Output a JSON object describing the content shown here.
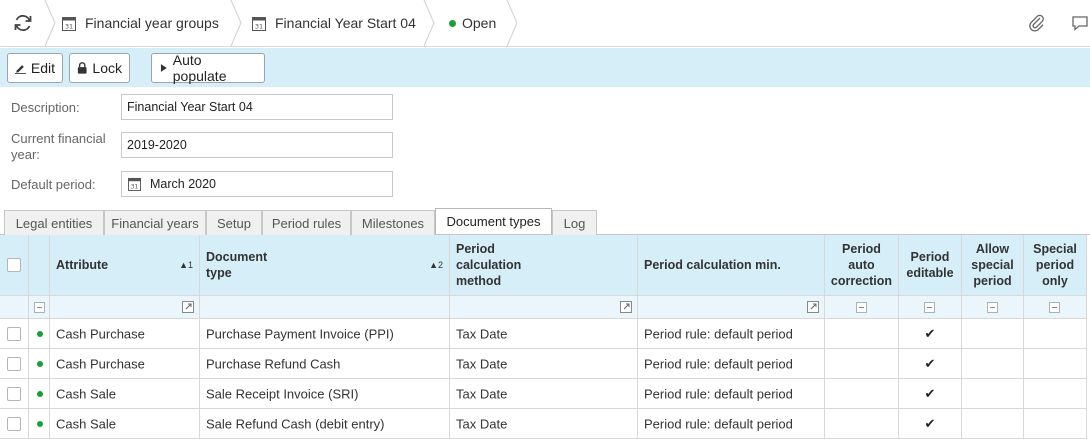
{
  "breadcrumb": {
    "item1": "Financial year groups",
    "item2": "Financial Year Start 04",
    "status": "Open"
  },
  "toolbar": {
    "edit": "Edit",
    "lock": "Lock",
    "auto_populate": "Auto populate"
  },
  "form": {
    "description_label": "Description:",
    "description_value": "Financial Year Start 04",
    "current_year_label_line1": "Current financial",
    "current_year_label_line2": "year:",
    "current_year_value": "2019-2020",
    "default_period_label": "Default period:",
    "default_period_value": "March 2020"
  },
  "tabs": [
    "Legal entities",
    "Financial years",
    "Setup",
    "Period rules",
    "Milestones",
    "Document types",
    "Log"
  ],
  "active_tab": "Document types",
  "columns": {
    "attribute": "Attribute",
    "attribute_sort": "1",
    "document_type_1": "Document",
    "document_type_2": "type",
    "document_type_sort": "2",
    "period_calc_1": "Period",
    "period_calc_2": "calculation",
    "period_calc_3": "method",
    "period_calc_min": "Period calculation min.",
    "auto_corr_1": "Period",
    "auto_corr_2": "auto",
    "auto_corr_3": "correction",
    "editable_1": "Period",
    "editable_2": "editable",
    "allow_special_1": "Allow",
    "allow_special_2": "special",
    "allow_special_3": "period",
    "special_only_1": "Special",
    "special_only_2": "period",
    "special_only_3": "only"
  },
  "rows": [
    {
      "attribute": "Cash Purchase",
      "document_type": "Purchase Payment Invoice (PPI)",
      "method": "Tax Date",
      "min": "Period rule: default period",
      "editable": "✔"
    },
    {
      "attribute": "Cash Purchase",
      "document_type": "Purchase Refund Cash",
      "method": "Tax Date",
      "min": "Period rule: default period",
      "editable": "✔"
    },
    {
      "attribute": "Cash Sale",
      "document_type": "Sale Receipt Invoice (SRI)",
      "method": "Tax Date",
      "min": "Period rule: default period",
      "editable": "✔"
    },
    {
      "attribute": "Cash Sale",
      "document_type": "Sale Refund Cash (debit entry)",
      "method": "Tax Date",
      "min": "Period rule: default period",
      "editable": "✔"
    }
  ],
  "icons": {
    "refresh": "refresh-icon",
    "calendar": "calendar-icon",
    "attach": "paperclip-icon",
    "comment": "comment-icon",
    "edit": "pencil-icon",
    "lock": "lock-icon",
    "play": "play-icon"
  },
  "colors": {
    "accent_bar": "#d5eef8",
    "status_green": "#1a9e3a"
  }
}
